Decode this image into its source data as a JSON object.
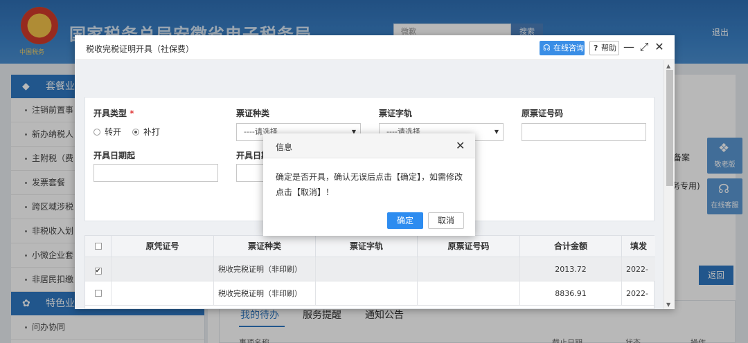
{
  "site": {
    "title": "国家税务总局安徽省电子税务局",
    "search_placeholder": "微歉",
    "search_label": "搜索",
    "logout_label": "退出",
    "emblem_text": "中国税务"
  },
  "sidebar": {
    "section1": "套餐业",
    "items": [
      "注销前置事",
      "新办纳税人",
      "主附税（费",
      "发票套餐",
      "跨区域涉税",
      "非税收入划",
      "小微企业套",
      "非居民扣缴"
    ],
    "section2": "特色业",
    "items2": [
      "问办协同"
    ]
  },
  "main": {
    "frag_beian": "备案",
    "frag_zhuanyong": "务专用)",
    "float_elder": "敬老版",
    "float_service": "在线客服",
    "back_label": "返回",
    "tabs": [
      "我的待办",
      "服务提醒",
      "通知公告"
    ],
    "cols": [
      "事项名称",
      "截止日期",
      "状态",
      "操作"
    ]
  },
  "modal": {
    "title": "税收完税证明开具（社保费）",
    "consult_label": "在线咨询",
    "help_label": "帮助",
    "form": {
      "issue_type_label": "开具类型",
      "required_mark": "*",
      "radio_options": [
        "转开",
        "补打"
      ],
      "selected_radio": "补打",
      "ticket_type_label": "票证种类",
      "ticket_type_value": "----请选择",
      "ticket_track_label": "票证字轨",
      "ticket_track_value": "----请选择",
      "orig_ticket_label": "原票证号码",
      "date_from_label": "开具日期起",
      "date_to_label": "开具日期"
    },
    "table": {
      "headers": [
        "原凭证号",
        "票证种类",
        "票证字轨",
        "原票证号码",
        "合计金额",
        "填发"
      ],
      "rows": [
        {
          "checked": true,
          "type": "税收完税证明（非印刷）",
          "amount": "2013.72",
          "date": "2022-"
        },
        {
          "checked": false,
          "type": "税收完税证明（非印刷）",
          "amount": "8836.91",
          "date": "2022-"
        }
      ]
    }
  },
  "dialog": {
    "title": "信息",
    "message": "确定是否开具，确认无误后点击【确定】，如需修改点击【取消】！",
    "ok_label": "确定",
    "cancel_label": "取消"
  },
  "colors": {
    "accent": "#2d8cf0",
    "header_blue": "#3b82c8",
    "required_red": "#e03a3a"
  },
  "icons": [
    "emblem-icon",
    "layers-icon",
    "gear-icon",
    "headset-icon",
    "question-icon",
    "minimize-icon",
    "maximize-icon",
    "close-icon",
    "elder-icon",
    "service-icon"
  ]
}
